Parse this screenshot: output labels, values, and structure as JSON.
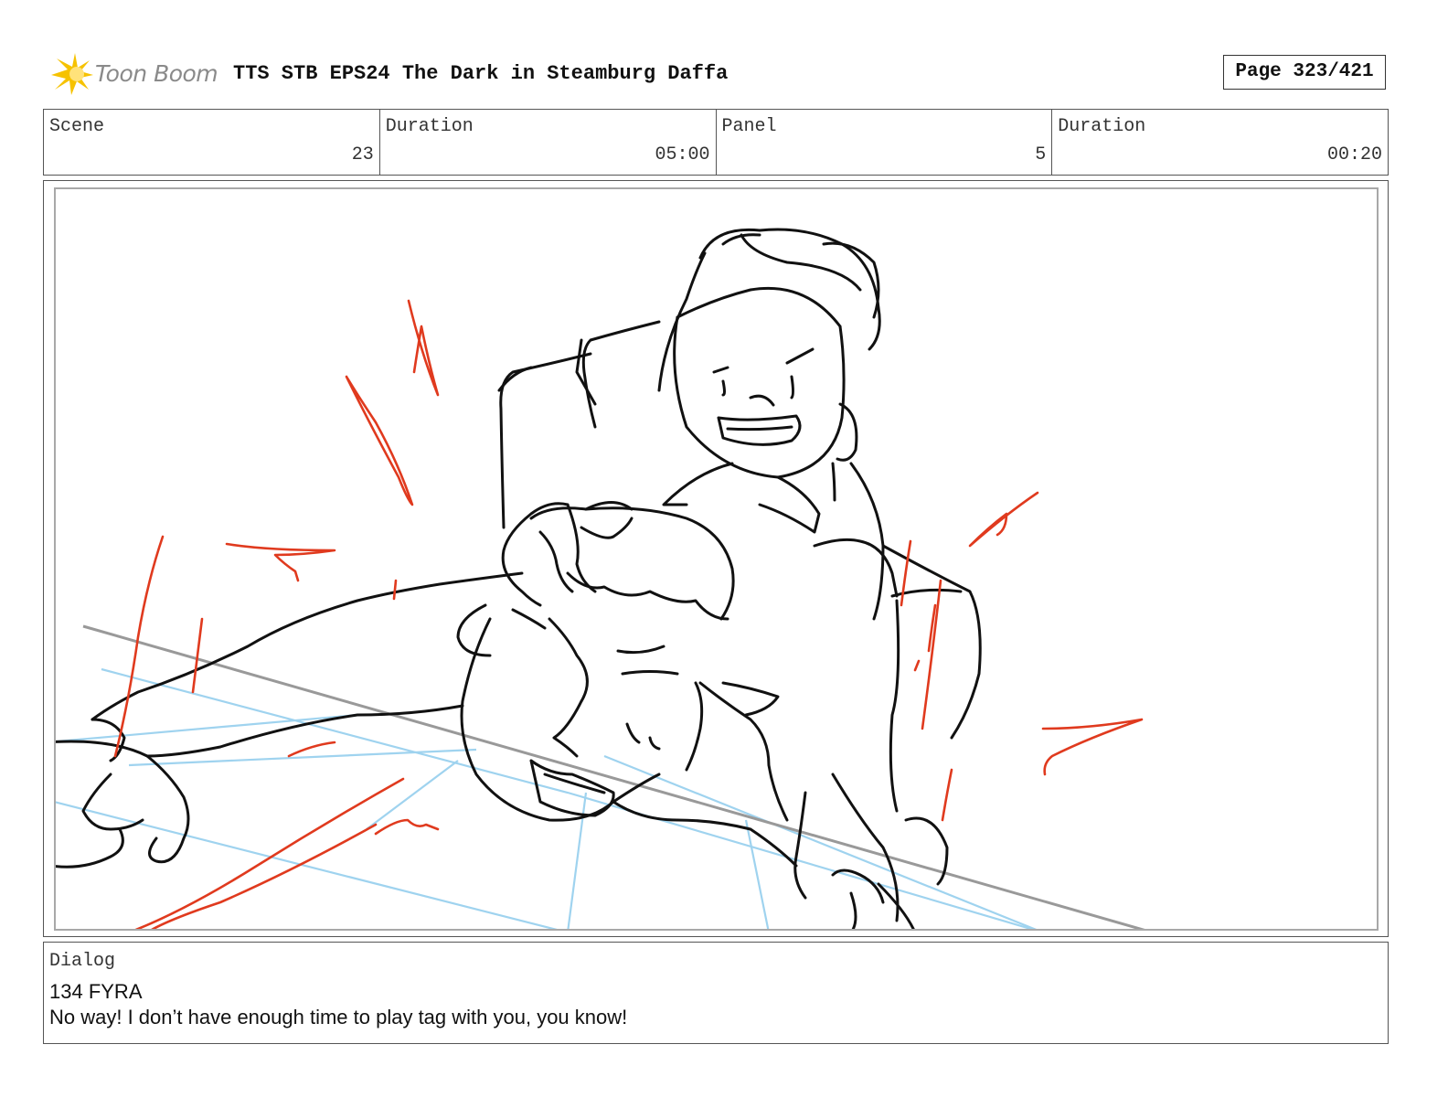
{
  "header": {
    "logo_text": "Toon Boom",
    "title": "TTS STB EPS24 The Dark in Steamburg Daffa",
    "page": "Page 323/421"
  },
  "info": {
    "scene_label": "Scene",
    "scene_value": "23",
    "scene_duration_label": "Duration",
    "scene_duration_value": "05:00",
    "panel_label": "Panel",
    "panel_value": "5",
    "panel_duration_label": "Duration",
    "panel_duration_value": "00:20"
  },
  "dialog": {
    "label": "Dialog",
    "speaker": "134 FYRA",
    "line": "No way! I don’t have enough time to play tag with you, you know!"
  },
  "colors": {
    "sketch_black": "#111111",
    "sketch_red": "#e03a1e",
    "sketch_blue": "#9fd3ef",
    "perspective_gray": "#999999",
    "logo_yellow": "#f6c200"
  }
}
